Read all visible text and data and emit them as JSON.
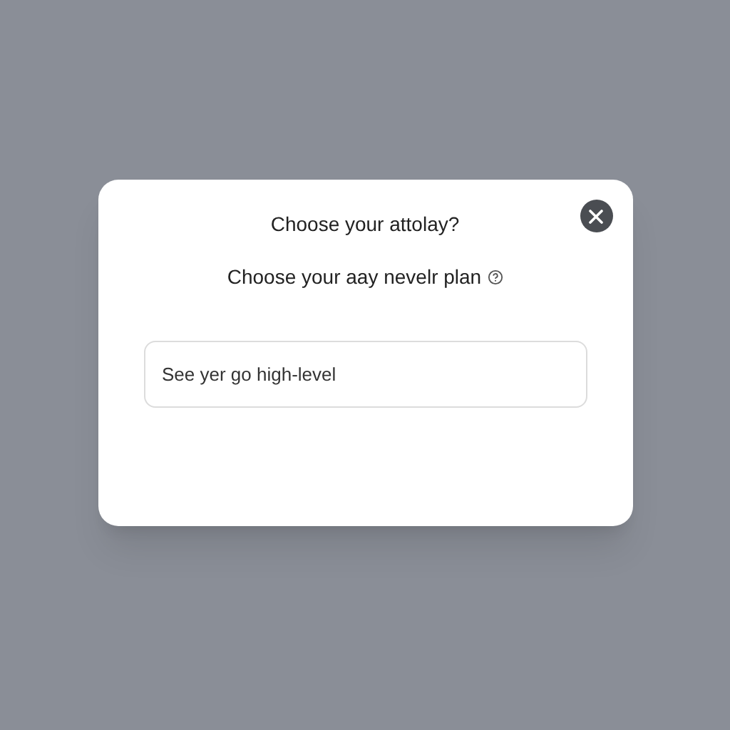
{
  "dialog": {
    "title": "Choose your attolay?",
    "subtitle": "Choose your aay nevelr plan",
    "field": {
      "value": "See yer go high-level"
    }
  }
}
